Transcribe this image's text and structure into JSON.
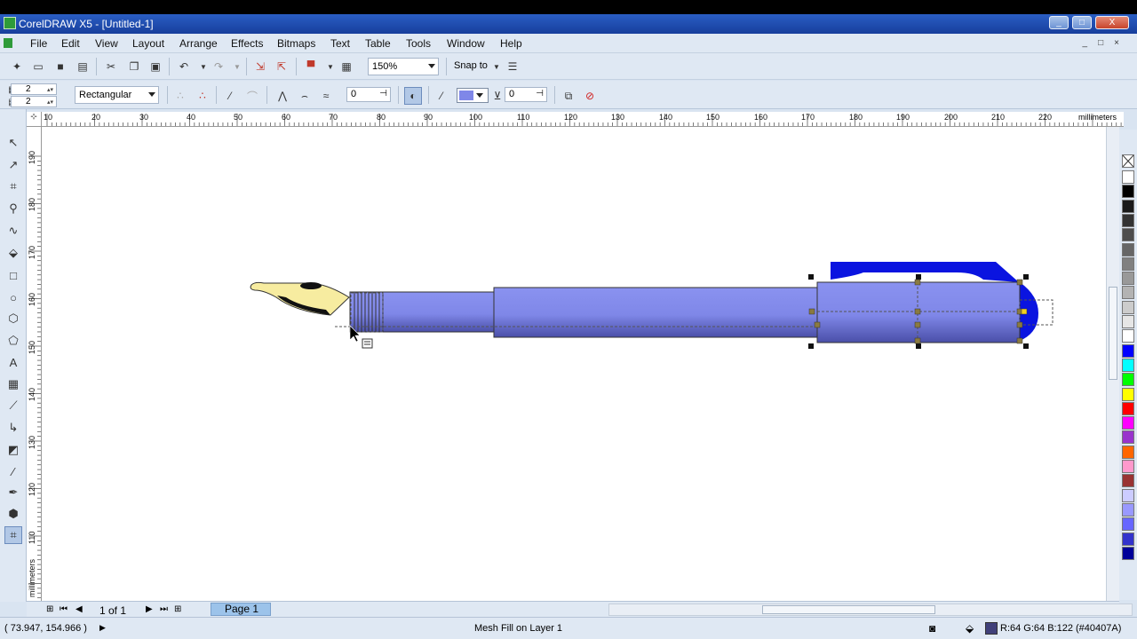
{
  "window": {
    "title": "CorelDRAW X5 - [Untitled-1]",
    "min": "_",
    "max": "□",
    "close": "X"
  },
  "menu": [
    "File",
    "Edit",
    "View",
    "Layout",
    "Arrange",
    "Effects",
    "Bitmaps",
    "Text",
    "Table",
    "Tools",
    "Window",
    "Help"
  ],
  "toolbar": {
    "zoom": "150%",
    "snap_to": "Snap to"
  },
  "propertybar": {
    "grid_columns": "2",
    "grid_rows": "2",
    "selection_mode": "Rectangular",
    "smoothing": "0",
    "transparency": "0",
    "fill_color": "#7f87e8"
  },
  "rulers": {
    "unit": "millimeters",
    "h_ticks": [
      "10",
      "20",
      "30",
      "40",
      "50",
      "60",
      "70",
      "80",
      "90",
      "100",
      "110",
      "120",
      "130",
      "140",
      "150",
      "160",
      "170",
      "180",
      "190",
      "200",
      "210",
      "220"
    ],
    "v_ticks": [
      "190",
      "180",
      "170",
      "160",
      "150",
      "140",
      "130",
      "120",
      "110"
    ],
    "v_unit": "millimeters"
  },
  "pagenav": {
    "page_count": "1 of 1",
    "tab": "Page 1"
  },
  "status": {
    "coords": "( 73.947, 154.966 )",
    "message": "Mesh Fill on Layer 1",
    "color_readout": "R:64 G:64 B:122 (#40407A)",
    "color_swatch": "#40407a"
  },
  "palette": [
    "#ffffff",
    "#000000",
    "#1a1a1a",
    "#333333",
    "#4d4d4d",
    "#666666",
    "#808080",
    "#999999",
    "#b3b3b3",
    "#cccccc",
    "#e6e6e6",
    "#ffffff",
    "#0000ff",
    "#00ffff",
    "#00ff00",
    "#ffff00",
    "#ff0000",
    "#ff00ff",
    "#9933cc",
    "#ff6600",
    "#ff99cc",
    "#993333",
    "#ccccff",
    "#9999ff",
    "#6666ff",
    "#3333cc",
    "#000099"
  ],
  "pen": {
    "body_color": "#7f87e8",
    "clip_color": "#0a14e0",
    "nib_color": "#f7eca0"
  }
}
